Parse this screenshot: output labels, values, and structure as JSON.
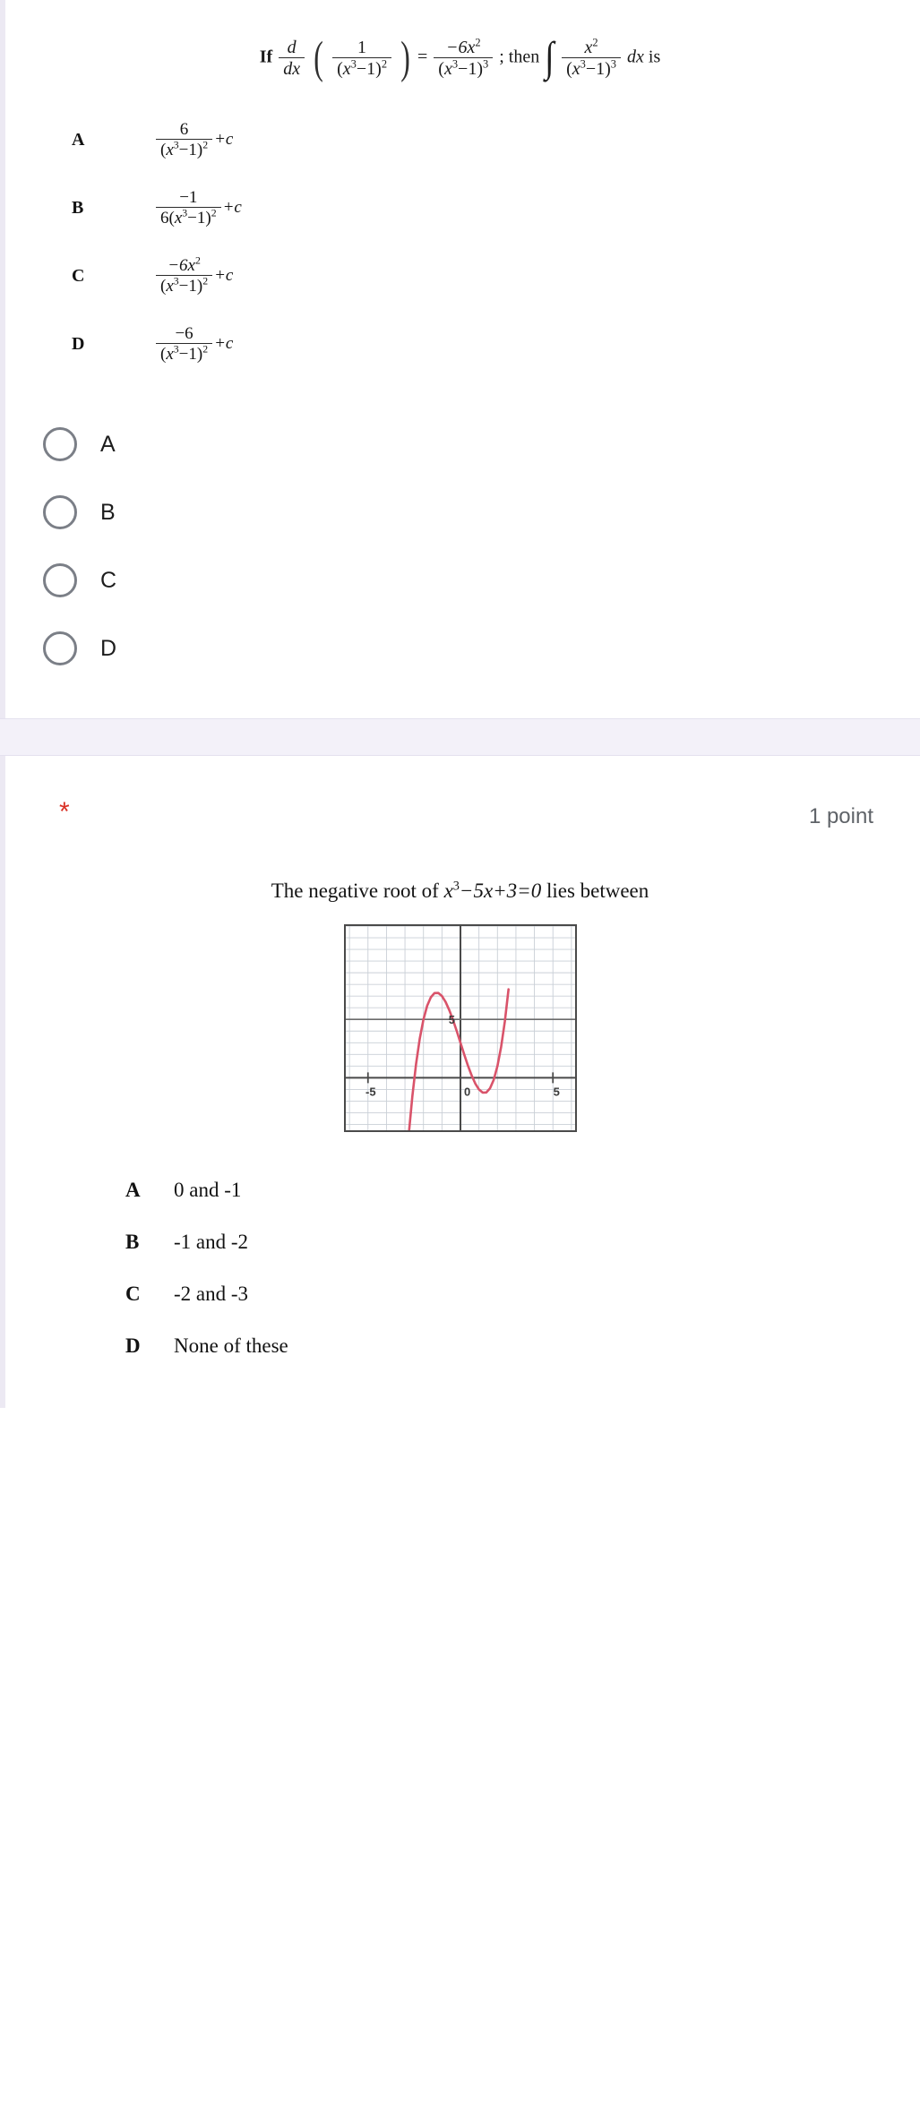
{
  "question1": {
    "stem": {
      "lead": "If",
      "operator_num": "d",
      "operator_den": "dx",
      "arg_num": "1",
      "arg_den_base": "x",
      "arg_den_exp": "3",
      "arg_den_tail": "−1",
      "arg_den_power": "2",
      "equals": "=",
      "rhs_num": "−6x",
      "rhs_num_exp": "2",
      "rhs_den_base": "x",
      "rhs_den_exp": "3",
      "rhs_den_tail": "−1",
      "rhs_den_power": "3",
      "connector": "; then",
      "integral": "∫",
      "int_num": "x",
      "int_num_exp": "2",
      "int_den_base": "x",
      "int_den_exp": "3",
      "int_den_tail": "−1",
      "int_den_power": "3",
      "dx": "dx",
      "tail": "is"
    },
    "image_options": [
      {
        "letter": "A",
        "num": "6",
        "den_prefix": "",
        "den_base": "x",
        "den_exp": "3",
        "den_tail": "−1",
        "den_power": "2",
        "suffix": "+c"
      },
      {
        "letter": "B",
        "num": "−1",
        "den_prefix": "6",
        "den_base": "x",
        "den_exp": "3",
        "den_tail": "−1",
        "den_power": "2",
        "suffix": "+c"
      },
      {
        "letter": "C",
        "num": "−6x",
        "num_exp": "2",
        "den_prefix": "",
        "den_base": "x",
        "den_exp": "3",
        "den_tail": "−1",
        "den_power": "2",
        "suffix": "+c"
      },
      {
        "letter": "D",
        "num": "−6",
        "den_prefix": "",
        "den_base": "x",
        "den_exp": "3",
        "den_tail": "−1",
        "den_power": "2",
        "suffix": "+c"
      }
    ],
    "radio_options": [
      {
        "label": "A",
        "selected": false
      },
      {
        "label": "B",
        "selected": false
      },
      {
        "label": "C",
        "selected": false
      },
      {
        "label": "D",
        "selected": false
      }
    ]
  },
  "question2": {
    "required_marker": "*",
    "points_label": "1 point",
    "stem_prefix": "The negative root of",
    "stem_poly_base": "x",
    "stem_poly_exp": "3",
    "stem_poly_tail": "−5x+3=0",
    "stem_suffix": "lies between",
    "options": [
      {
        "letter": "A",
        "text": "0 and -1"
      },
      {
        "letter": "B",
        "text": "-1 and -2"
      },
      {
        "letter": "C",
        "text": "-2 and -3"
      },
      {
        "letter": "D",
        "text": "None of these"
      }
    ]
  },
  "chart_data": {
    "type": "line",
    "title": "",
    "xlabel": "",
    "ylabel": "",
    "expression": "y = x^3 - 5x + 3",
    "xlim": [
      -6.2,
      6.2
    ],
    "ylim": [
      -4.5,
      13.0
    ],
    "xticks": [
      -5,
      0,
      5
    ],
    "xtick_labels": [
      "-5",
      "0",
      "5"
    ],
    "yticks": [
      5
    ],
    "ytick_labels": [
      "5"
    ],
    "grid": true,
    "grid_step": 1,
    "grid_color": "#c9cfd6",
    "axis_color": "#4a4a4a",
    "curve_color": "#d9536a",
    "curve_width": 2.6,
    "roots": [
      -2.49,
      0.657,
      1.834
    ],
    "legend": "none",
    "x": [
      -3.2,
      -3.0,
      -2.8,
      -2.6,
      -2.4,
      -2.2,
      -2.0,
      -1.8,
      -1.6,
      -1.4,
      -1.2,
      -1.0,
      -0.8,
      -0.6,
      -0.4,
      -0.2,
      0.0,
      0.2,
      0.4,
      0.6,
      0.8,
      1.0,
      1.2,
      1.4,
      1.6,
      1.8,
      2.0,
      2.2,
      2.4,
      2.6
    ],
    "y": [
      -13.77,
      -9.0,
      -4.95,
      -1.58,
      1.18,
      3.35,
      5.0,
      6.17,
      6.9,
      7.26,
      7.27,
      7.0,
      6.49,
      5.78,
      4.94,
      4.0,
      3.0,
      2.01,
      1.06,
      0.22,
      -0.49,
      -1.0,
      -1.27,
      -1.26,
      -0.9,
      -0.17,
      1.0,
      2.65,
      4.82,
      7.58
    ]
  }
}
